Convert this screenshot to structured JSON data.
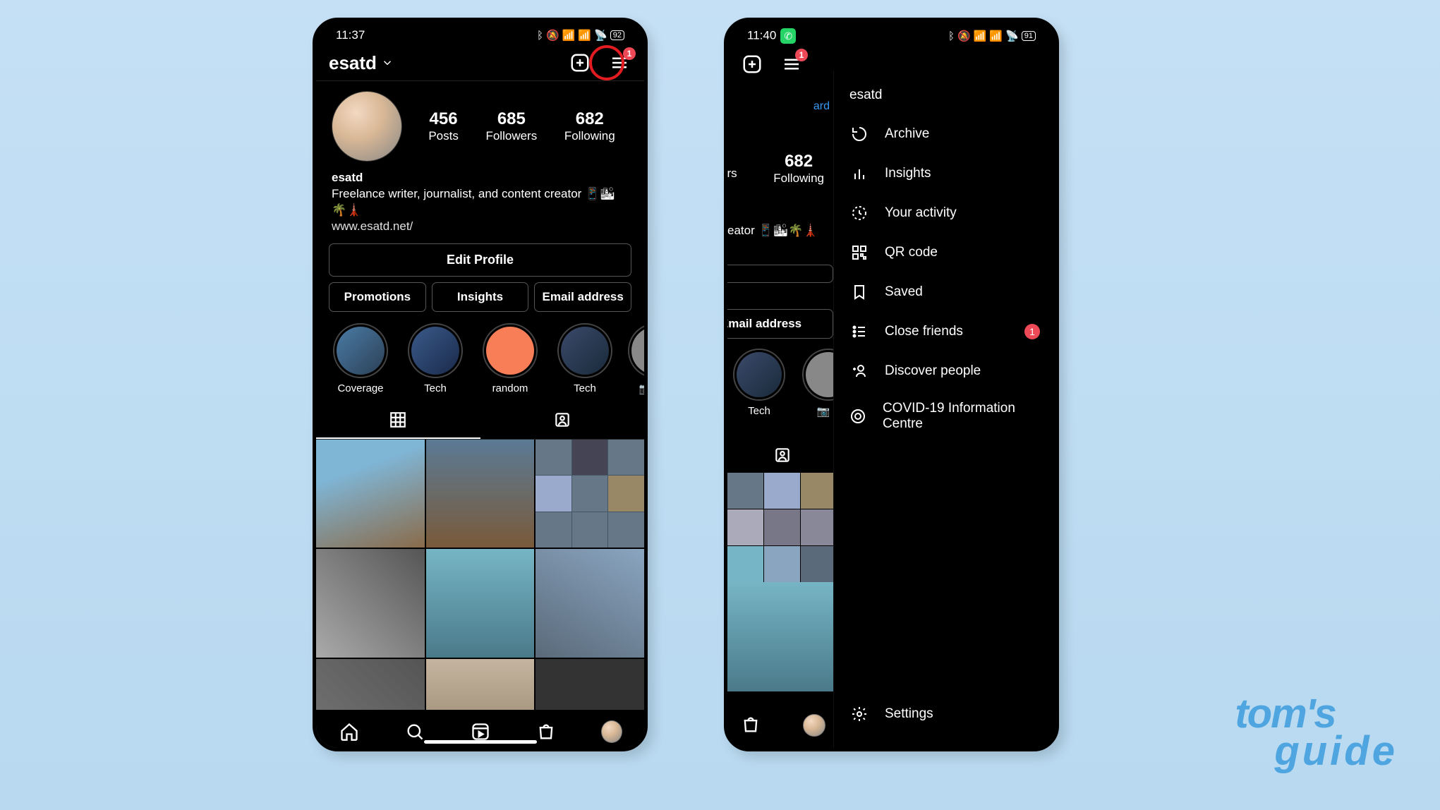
{
  "phone1": {
    "time": "11:37",
    "battery": "92",
    "username": "esatd",
    "badge": "1",
    "stats": {
      "posts_n": "456",
      "posts_l": "Posts",
      "followers_n": "685",
      "followers_l": "Followers",
      "following_n": "682",
      "following_l": "Following"
    },
    "bio_name": "esatd",
    "bio_text": "Freelance writer, journalist, and content creator 📱🏙🌴🗼",
    "bio_link": "www.esatd.net/",
    "edit": "Edit Profile",
    "promo": "Promotions",
    "insights": "Insights",
    "email": "Email address",
    "hl": [
      "Coverage",
      "Tech",
      "random",
      "Tech",
      "📷"
    ]
  },
  "phone2": {
    "time": "11:40",
    "battery": "91",
    "badge": "1",
    "following_n": "682",
    "following_l": "Following",
    "bio_frag": "eator 📱🏙🌴🗼",
    "ers": "ers",
    "ard": "ard",
    "email": "Email address",
    "hl": [
      "Tech",
      "📷"
    ],
    "menu_user": "esatd",
    "menu": [
      {
        "label": "Archive"
      },
      {
        "label": "Insights"
      },
      {
        "label": "Your activity"
      },
      {
        "label": "QR code"
      },
      {
        "label": "Saved"
      },
      {
        "label": "Close friends",
        "badge": "1"
      },
      {
        "label": "Discover people"
      },
      {
        "label": "COVID-19 Information Centre"
      }
    ],
    "settings": "Settings"
  },
  "brand": {
    "l1": "tom's",
    "l2": "guide"
  }
}
